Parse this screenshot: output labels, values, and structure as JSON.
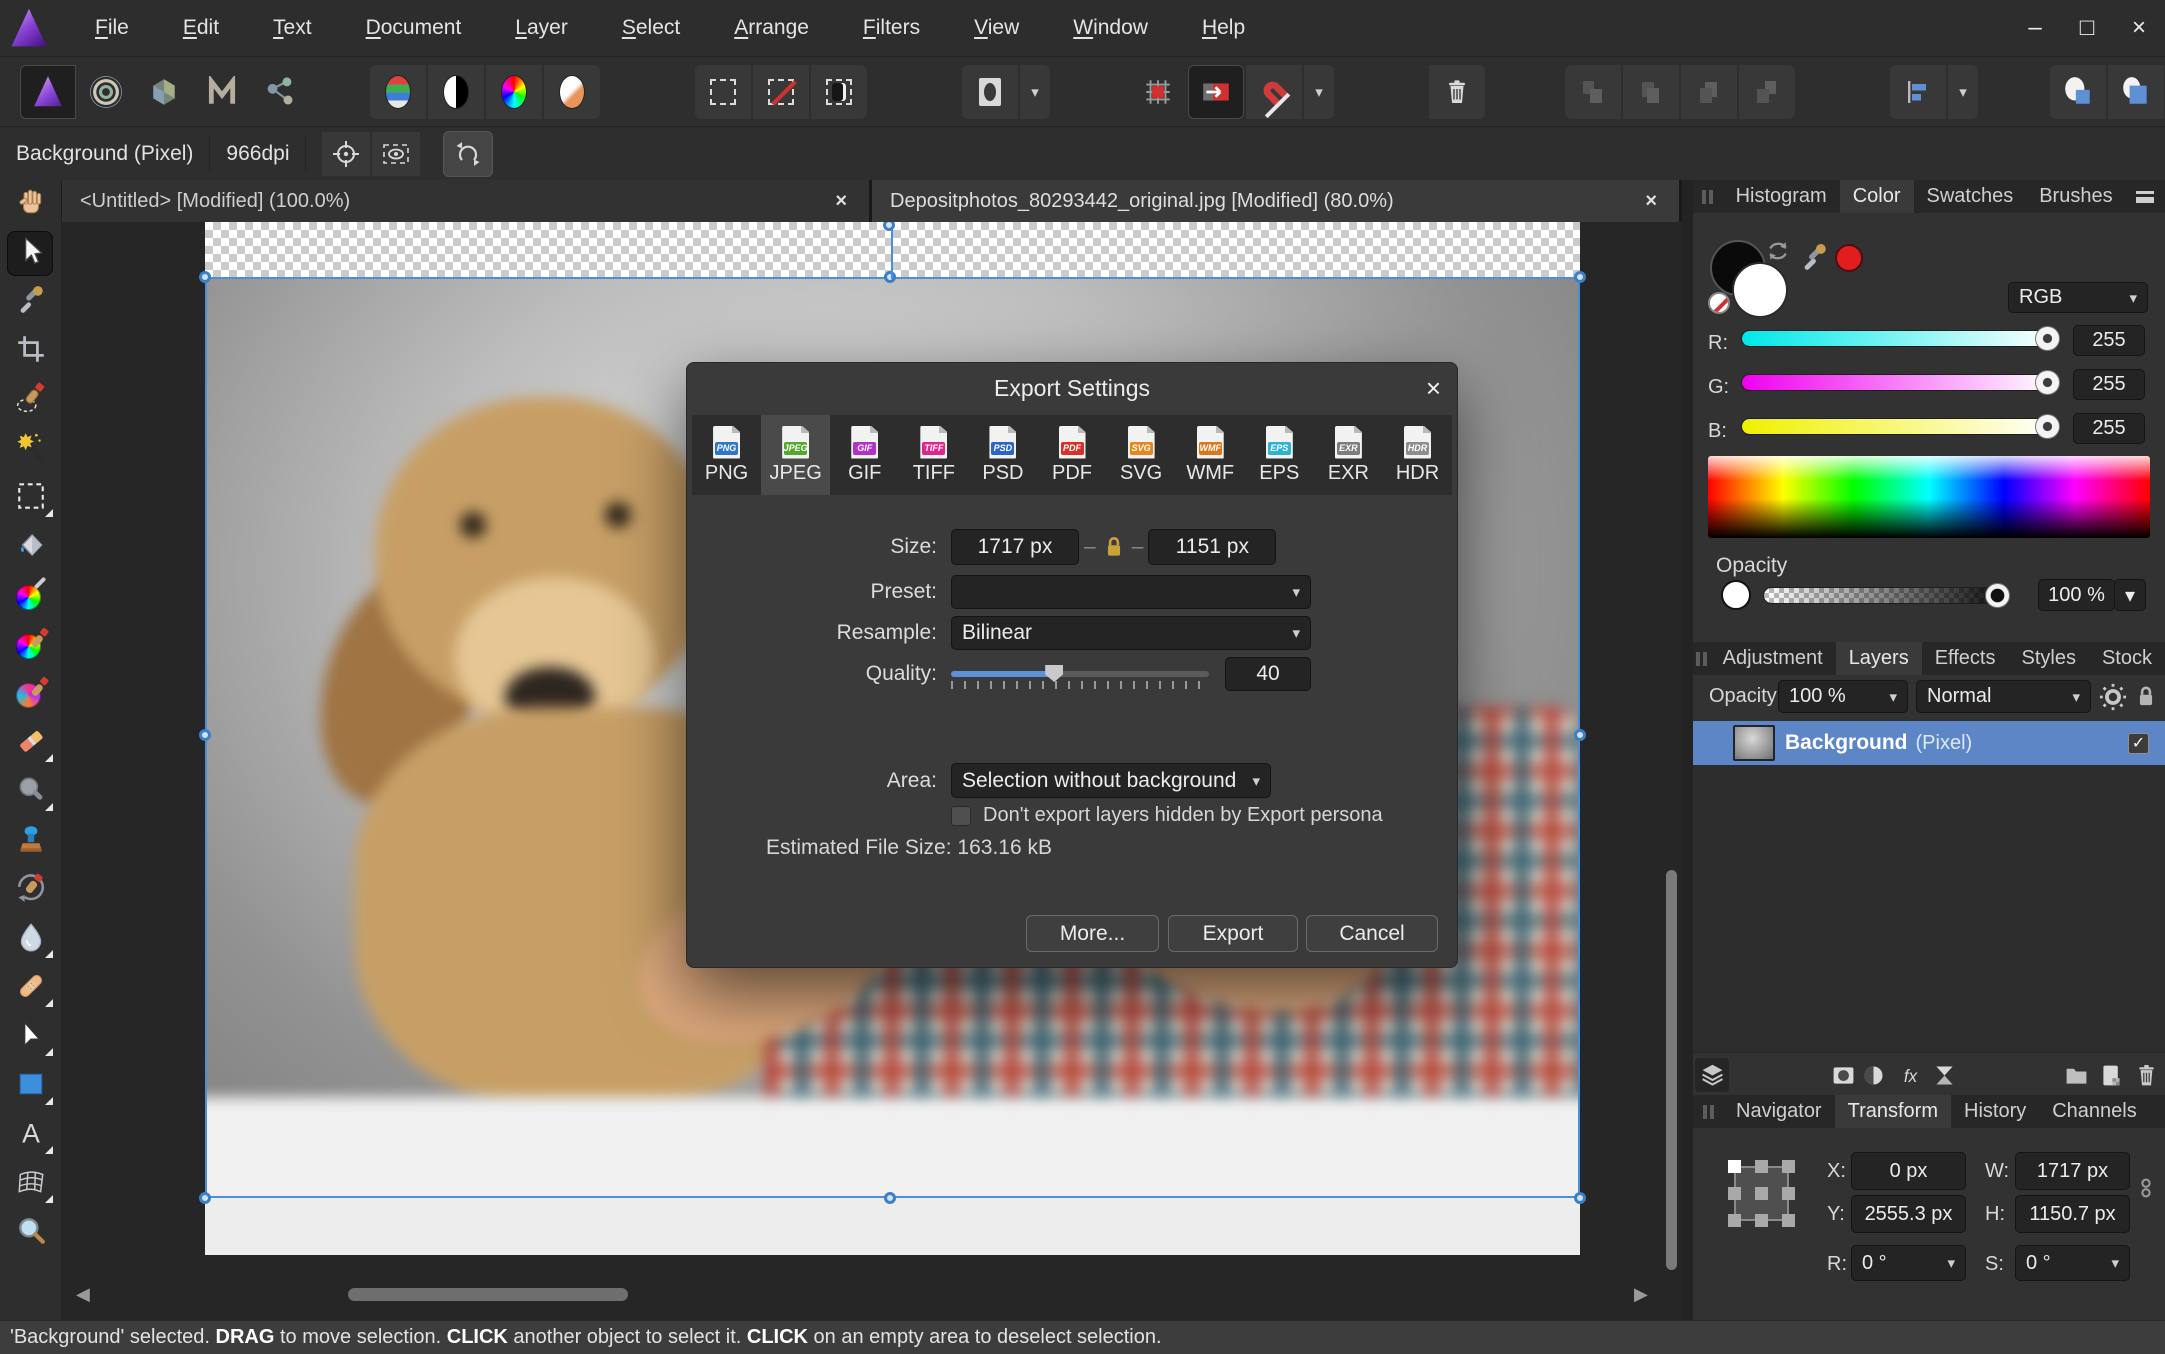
{
  "colors": {
    "accent": "#5f8fd4",
    "layer_selected": "#5d86c6",
    "selection_blue": "#4c8fd9"
  },
  "icons": {
    "close": "×",
    "dropdown": "▾",
    "check": "✓",
    "min": "–",
    "max": "□",
    "scroll_left": "◀",
    "scroll_right": "▶",
    "lock_dash": "–"
  },
  "menu_bar": {
    "items": [
      {
        "label": "File"
      },
      {
        "label": "Edit"
      },
      {
        "label": "Text"
      },
      {
        "label": "Document"
      },
      {
        "label": "Layer"
      },
      {
        "label": "Select"
      },
      {
        "label": "Arrange"
      },
      {
        "label": "Filters"
      },
      {
        "label": "View"
      },
      {
        "label": "Window"
      },
      {
        "label": "Help"
      }
    ]
  },
  "context_bar": {
    "layer_label": "Background (Pixel)",
    "dpi": "966dpi"
  },
  "document_tabs": [
    {
      "label": "<Untitled> [Modified] (100.0%)"
    },
    {
      "label": "Depositphotos_80293442_original.jpg [Modified] (80.0%)",
      "active": true
    }
  ],
  "tools": [
    {
      "name": "view-tool",
      "icon": "view"
    },
    {
      "name": "move-tool",
      "icon": "move",
      "active": true
    },
    {
      "name": "colour-picker-tool",
      "icon": "picker"
    },
    {
      "name": "crop-tool",
      "icon": "crop"
    },
    {
      "name": "selection-brush-tool",
      "icon": "selbrush"
    },
    {
      "name": "flood-select-tool",
      "icon": "wand"
    },
    {
      "name": "rectangular-marquee-tool",
      "icon": "marquee",
      "tri": true
    },
    {
      "name": "flood-fill-tool",
      "icon": "bucket"
    },
    {
      "name": "gradient-tool",
      "icon": "gradient"
    },
    {
      "name": "paint-brush-tool",
      "icon": "paintbrush"
    },
    {
      "name": "colour-replacement-brush-tool",
      "icon": "colourbrush"
    },
    {
      "name": "erase-brush-tool",
      "icon": "eraser",
      "tri": true
    },
    {
      "name": "dodge-brush-tool",
      "icon": "dodge",
      "tri": true
    },
    {
      "name": "clone-brush-tool",
      "icon": "clone"
    },
    {
      "name": "undo-brush-tool",
      "icon": "undobrush"
    },
    {
      "name": "blur-tool",
      "icon": "blur",
      "tri": true
    },
    {
      "name": "healing-brush-tool",
      "icon": "healing",
      "tri": true
    },
    {
      "name": "node-tool",
      "icon": "node",
      "tri": true
    },
    {
      "name": "rectangle-tool",
      "icon": "rect",
      "tri": true
    },
    {
      "name": "artistic-text-tool",
      "icon": "text",
      "tri": true
    },
    {
      "name": "mesh-warp-tool",
      "icon": "mesh",
      "tri": true
    },
    {
      "name": "zoom-tool",
      "icon": "zoom"
    }
  ],
  "export_dialog": {
    "title": "Export Settings",
    "formats": [
      {
        "label": "PNG",
        "badge_color": "#2f76c9"
      },
      {
        "label": "JPEG",
        "badge_color": "#54a82e",
        "selected": true
      },
      {
        "label": "GIF",
        "badge_color": "#b231c9"
      },
      {
        "label": "TIFF",
        "badge_color": "#e0268c"
      },
      {
        "label": "PSD",
        "badge_color": "#2b66c4"
      },
      {
        "label": "PDF",
        "badge_color": "#d92f2a"
      },
      {
        "label": "SVG",
        "badge_color": "#e8861c"
      },
      {
        "label": "WMF",
        "badge_color": "#dd7617"
      },
      {
        "label": "EPS",
        "badge_color": "#2cb3d6"
      },
      {
        "label": "EXR",
        "badge_color": "#7d7d7d"
      },
      {
        "label": "HDR",
        "badge_color": "#8d8d8d"
      }
    ],
    "size_label": "Size:",
    "size_w": "1717 px",
    "size_h": "1151 px",
    "preset_label": "Preset:",
    "preset_value": "",
    "resample_label": "Resample:",
    "resample_value": "Bilinear",
    "quality_label": "Quality:",
    "quality_value": "40",
    "quality_percent": 40,
    "area_label": "Area:",
    "area_value": "Selection without background",
    "checkbox_label": "Don't export layers hidden by Export persona",
    "checkbox_checked": false,
    "filesize_label": "Estimated File Size:",
    "filesize_value": "163.16 kB",
    "buttons": {
      "more": "More...",
      "export": "Export",
      "cancel": "Cancel"
    }
  },
  "color_panel": {
    "tabs": [
      {
        "label": "Histogram"
      },
      {
        "label": "Color",
        "active": true
      },
      {
        "label": "Swatches"
      },
      {
        "label": "Brushes"
      }
    ],
    "mode": "RGB",
    "sliders": [
      {
        "label": "R:",
        "value": "255"
      },
      {
        "label": "G:",
        "value": "255"
      },
      {
        "label": "B:",
        "value": "255"
      }
    ],
    "opacity_label": "Opacity",
    "opacity_value": "100 %"
  },
  "layers_panel": {
    "tabs": [
      {
        "label": "Adjustment"
      },
      {
        "label": "Layers",
        "active": true
      },
      {
        "label": "Effects"
      },
      {
        "label": "Styles"
      },
      {
        "label": "Stock"
      }
    ],
    "opacity_label": "Opacity:",
    "opacity_value": "100 %",
    "blend_mode": "Normal",
    "layers": [
      {
        "name": "Background",
        "type": "(Pixel)",
        "checked": true
      }
    ]
  },
  "transform_panel": {
    "tabs": [
      {
        "label": "Navigator"
      },
      {
        "label": "Transform",
        "active": true
      },
      {
        "label": "History"
      },
      {
        "label": "Channels"
      }
    ],
    "x_label": "X:",
    "x_value": "0 px",
    "y_label": "Y:",
    "y_value": "2555.3 px",
    "w_label": "W:",
    "w_value": "1717 px",
    "h_label": "H:",
    "h_value": "1150.7 px",
    "r_label": "R:",
    "r_value": "0 °",
    "s_label": "S:",
    "s_value": "0 °"
  },
  "status_bar": {
    "segments": [
      {
        "text": "'Background' selected. "
      },
      {
        "text": "DRAG",
        "bold": true
      },
      {
        "text": " to move selection. "
      },
      {
        "text": "CLICK",
        "bold": true
      },
      {
        "text": " another object to select it. "
      },
      {
        "text": "CLICK",
        "bold": true
      },
      {
        "text": " on an empty area to deselect selection."
      }
    ]
  }
}
